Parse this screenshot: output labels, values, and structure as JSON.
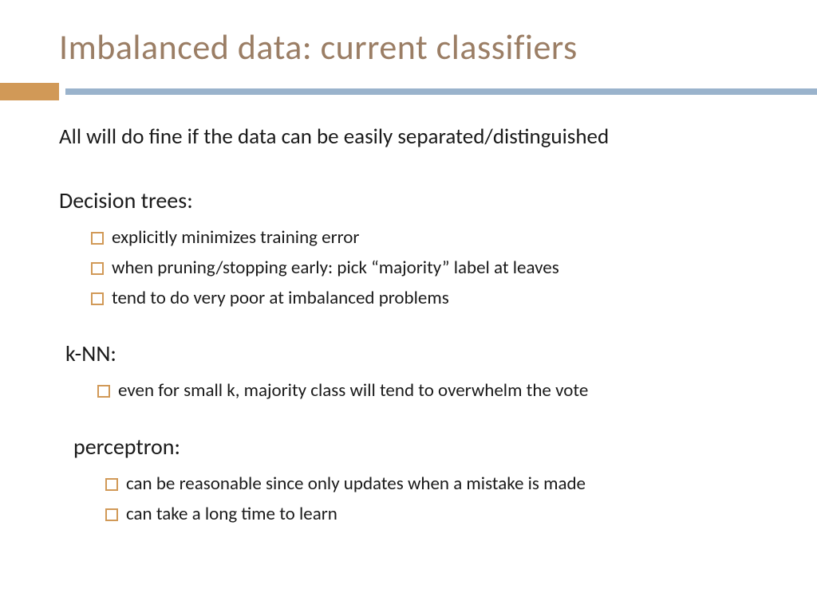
{
  "title": "Imbalanced data: current classifiers",
  "intro": "All will do fine if the data can be easily separated/distinguished",
  "sections": [
    {
      "heading": "Decision trees:",
      "items": [
        "explicitly minimizes training error",
        "when pruning/stopping early: pick “majority” label at leaves",
        "tend to do very poor at imbalanced problems"
      ]
    },
    {
      "heading": "k-NN:",
      "items": [
        "even for small k, majority class will tend to overwhelm the vote"
      ]
    },
    {
      "heading": "perceptron:",
      "items": [
        "can be reasonable since only updates when a mistake is made",
        "can take a long time to learn"
      ]
    }
  ]
}
